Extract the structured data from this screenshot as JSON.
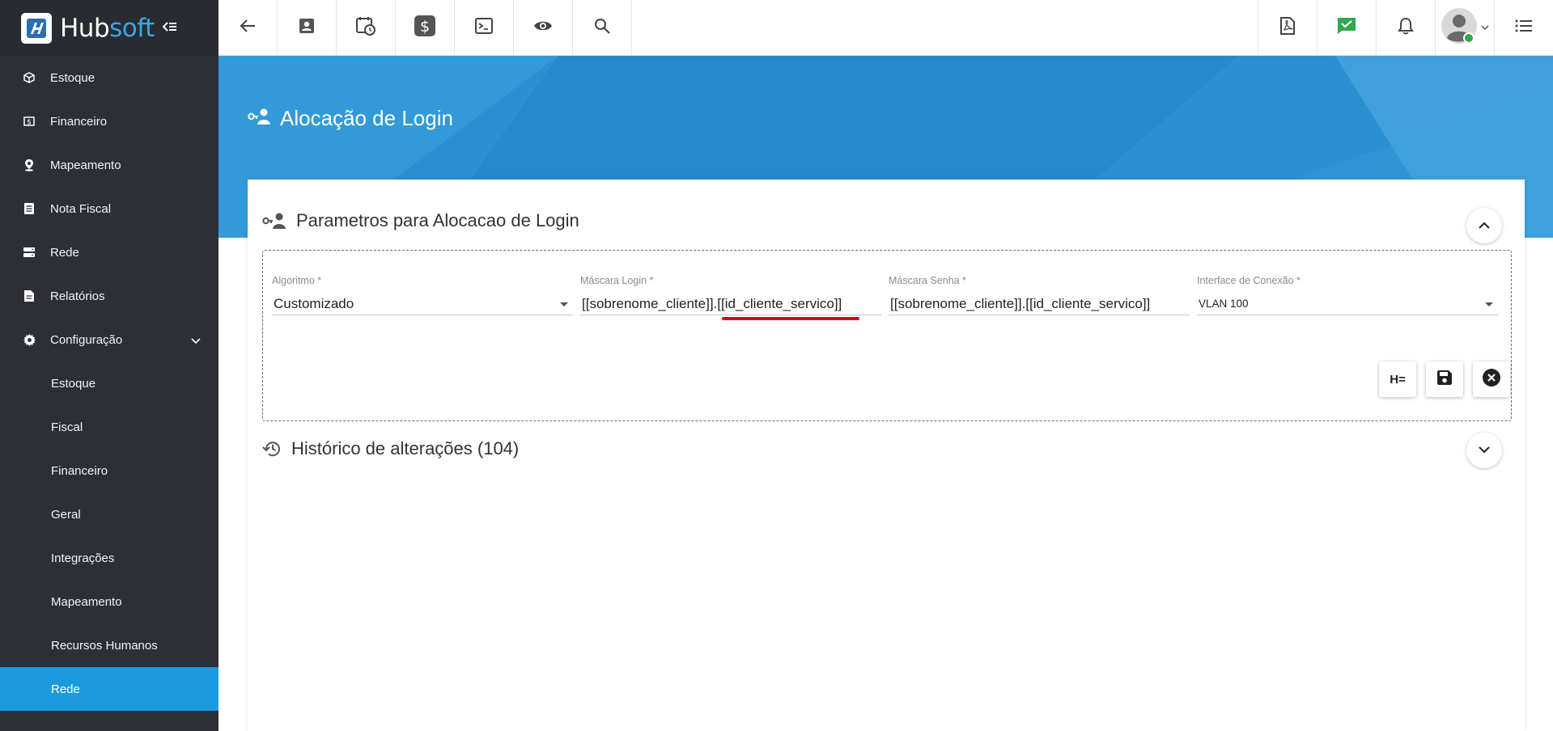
{
  "brand": {
    "name_part1": "Hub",
    "name_part2": "soft",
    "accent": "#38a7e4"
  },
  "sidebar": {
    "items": [
      {
        "label": "Estoque",
        "icon": "box-icon"
      },
      {
        "label": "Financeiro",
        "icon": "dollar-icon"
      },
      {
        "label": "Mapeamento",
        "icon": "map-pin-icon"
      },
      {
        "label": "Nota Fiscal",
        "icon": "receipt-icon"
      },
      {
        "label": "Rede",
        "icon": "server-icon"
      },
      {
        "label": "Relatórios",
        "icon": "report-icon"
      },
      {
        "label": "Configuração",
        "icon": "gear-icon",
        "expanded": true
      }
    ],
    "subitems": [
      {
        "label": "Estoque"
      },
      {
        "label": "Fiscal"
      },
      {
        "label": "Financeiro"
      },
      {
        "label": "Geral"
      },
      {
        "label": "Integrações"
      },
      {
        "label": "Mapeamento"
      },
      {
        "label": "Recursos Humanos"
      },
      {
        "label": "Rede",
        "active": true
      }
    ],
    "active_color": "#1a9be0"
  },
  "topbar": {
    "left_icons": [
      "back-arrow-icon",
      "contact-card-icon",
      "calendar-clock-icon",
      "dollar-icon",
      "terminal-icon",
      "eye-icon",
      "search-icon"
    ],
    "right_icons": [
      "pdf-icon",
      "check-message-icon",
      "bell-icon",
      "avatar",
      "menu-list-icon"
    ]
  },
  "page": {
    "title": "Alocação de Login"
  },
  "params_section": {
    "title": "Parametros para Alocacao de Login",
    "fields": {
      "algoritmo": {
        "label": "Algoritmo *",
        "value": "Customizado"
      },
      "mascara_login": {
        "label": "Máscara Login *",
        "value": "[[sobrenome_cliente]].[[id_cliente_servico]]"
      },
      "mascara_senha": {
        "label": "Máscara Senha *",
        "value": "[[sobrenome_cliente]].[[id_cliente_servico]]"
      },
      "interface": {
        "label": "Interface de Conexão *",
        "value": "VLAN 100"
      }
    },
    "help_button_label": "H="
  },
  "history_section": {
    "title": "Histórico de alterações (104)"
  }
}
